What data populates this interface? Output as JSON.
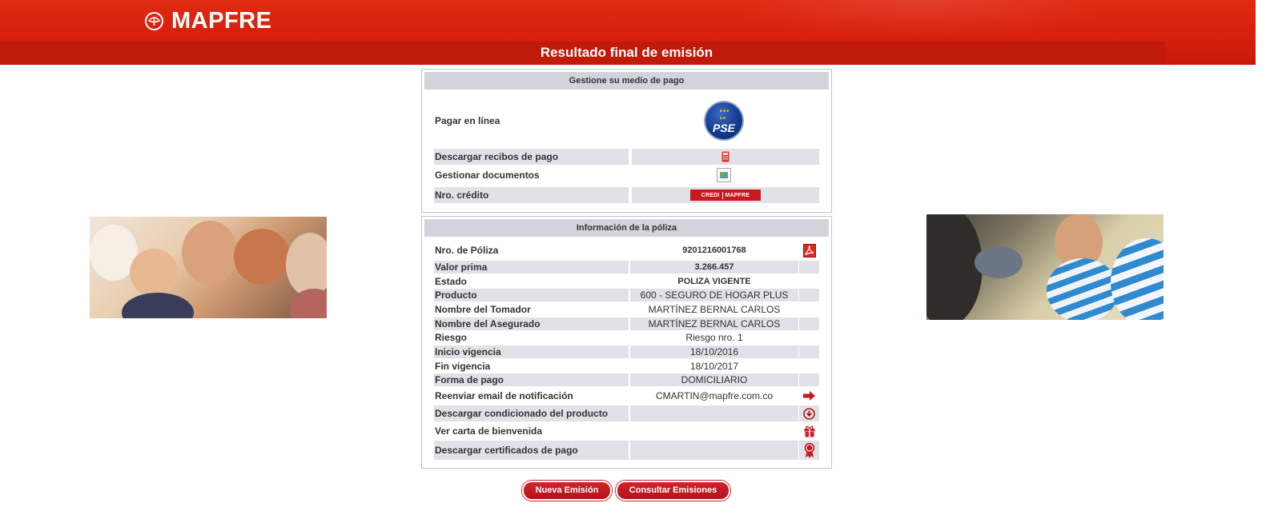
{
  "header": {
    "brand": "MAPFRE",
    "title": "Resultado final de emisión"
  },
  "payment": {
    "heading": "Gestione su medio de pago",
    "online": "Pagar en línea",
    "pse_text": "PSE",
    "receipts": "Descargar recibos de pago",
    "documents": "Gestionar documentos",
    "credit": "Nro. crédito",
    "credi_left": "CREDI",
    "credi_right": "MAPFRE"
  },
  "policy": {
    "heading": "Información de la póliza",
    "rows": [
      {
        "label": "Nro. de Póliza",
        "value": "9201216001768",
        "icon": "pdf-icon"
      },
      {
        "label": "Valor prima",
        "value": "3.266.457"
      },
      {
        "label": "Estado",
        "value": "POLIZA VIGENTE"
      },
      {
        "label": "Producto",
        "value": "600 - SEGURO DE HOGAR PLUS"
      },
      {
        "label": "Nombre del Tomador",
        "value": "MARTÍNEZ BERNAL CARLOS"
      },
      {
        "label": "Nombre del Asegurado",
        "value": "MARTÍNEZ BERNAL CARLOS"
      },
      {
        "label": "Riesgo",
        "value": "Riesgo nro. 1"
      },
      {
        "label": "Inicio vigencia",
        "value": "18/10/2016"
      },
      {
        "label": "Fin vigencia",
        "value": "18/10/2017"
      },
      {
        "label": "Forma de pago",
        "value": "DOMICILIARIO"
      },
      {
        "label": "Reenviar email de notificación",
        "value": "CMARTIN@mapfre.com.co",
        "icon": "arrow-right-icon"
      },
      {
        "label": "Descargar condicionado del producto",
        "value": "",
        "icon": "download-icon"
      },
      {
        "label": "Ver carta de bienvenida",
        "value": "",
        "icon": "gift-icon"
      },
      {
        "label": "Descargar certificados de pago",
        "value": "",
        "icon": "certificate-icon"
      }
    ]
  },
  "buttons": {
    "new": "Nueva Emisión",
    "query": "Consultar Emisiones"
  },
  "colors": {
    "brand_red": "#d51f0b",
    "button_red": "#c21820",
    "status_green": "#2f9a2f",
    "policy_red": "#8b1a1a",
    "row_shade": "#e1e1e8"
  }
}
